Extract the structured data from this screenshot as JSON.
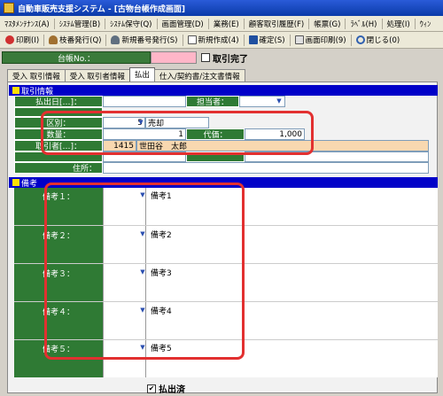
{
  "window": {
    "title": "自動車販売支援システム - [古物台帳作成画面]"
  },
  "menu": [
    "ﾏｽﾀﾒﾝﾃﾅﾝｽ(A)",
    "ｼｽﾃﾑ管理(B)",
    "ｼｽﾃﾑ保守(Q)",
    "画面管理(D)",
    "業務(E)",
    "顧客取引履歴(F)",
    "帳票(G)",
    "ﾗﾍﾞﾙ(H)",
    "処理(I)",
    "ｳｨﾝ"
  ],
  "toolbar": {
    "print": "印刷(I)",
    "issue_no": "枝番発行(Q)",
    "new_no": "新規番号発行(S)",
    "new_create": "新規作成(4)",
    "confirm": "確定(S)",
    "screen_print": "画面印刷(9)",
    "close": "閉じる(0)"
  },
  "header": {
    "ledger_label": "台帳No.：",
    "ledger_value": "",
    "deal_done": "取引完了"
  },
  "tabs": [
    "受入 取引情報",
    "受入 取引者情報",
    "払出",
    "仕入/契約書/注文書情報"
  ],
  "active_tab": 2,
  "deal_section": {
    "title": "取引情報",
    "payout_date_label": "払出日[…]：",
    "payout_date_value": "",
    "handler_label": "担当者：",
    "handler_value": "",
    "kind_label": "区別：",
    "kind_code": "5",
    "kind_value": "売却",
    "qty_label": "数量：",
    "qty_value": "1",
    "price_label": "代価：",
    "price_value": "1,000",
    "partner_label": "取引者[…]：",
    "partner_code": "1415",
    "partner_name": "世田谷　太郎",
    "address_label": "住所："
  },
  "remarks": {
    "title": "備考",
    "items": [
      {
        "label": "備考１：",
        "value": "備考1"
      },
      {
        "label": "備考２：",
        "value": "備考2"
      },
      {
        "label": "備考３：",
        "value": "備考3"
      },
      {
        "label": "備考４：",
        "value": "備考4"
      },
      {
        "label": "備考５：",
        "value": "備考5"
      }
    ]
  },
  "footer": {
    "paid_out": "払出済",
    "paid_out_checked": true
  },
  "colors": {
    "label_green": "#2f7a34",
    "section_blue": "#0000c8",
    "highlight_red": "#e23030",
    "pink": "#ffb6c8"
  }
}
